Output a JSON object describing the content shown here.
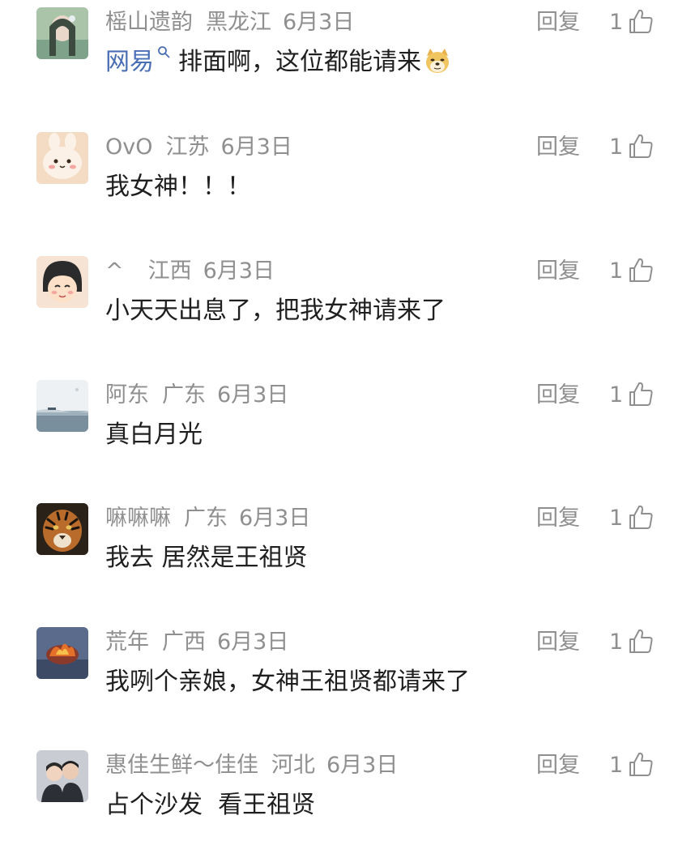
{
  "comments": [
    {
      "username": "榣山遗韵",
      "location": "黑龙江",
      "date": "6月3日",
      "link_word": "网易",
      "text": "排面啊，这位都能请来",
      "reply_label": "回复",
      "likes": "1",
      "avatar": "anime-girl-avatar"
    },
    {
      "username": "OvO",
      "location": "江苏",
      "date": "6月3日",
      "text": "我女神！！！",
      "reply_label": "回复",
      "likes": "1",
      "avatar": "bunny-avatar"
    },
    {
      "username": "^",
      "location": "江西",
      "date": "6月3日",
      "text": "小天天出息了，把我女神请来了",
      "reply_label": "回复",
      "likes": "1",
      "avatar": "cartoon-girl-avatar"
    },
    {
      "username": "阿东",
      "location": "广东",
      "date": "6月3日",
      "text": "真白月光",
      "reply_label": "回复",
      "likes": "1",
      "avatar": "sea-landscape-avatar"
    },
    {
      "username": "嘛嘛嘛",
      "location": "广东",
      "date": "6月3日",
      "text": "我去 居然是王祖贤",
      "reply_label": "回复",
      "likes": "1",
      "avatar": "tiger-avatar"
    },
    {
      "username": "荒年",
      "location": "广西",
      "date": "6月3日",
      "text": "我咧个亲娘，女神王祖贤都请来了",
      "reply_label": "回复",
      "likes": "1",
      "avatar": "fire-avatar"
    },
    {
      "username": "惠佳生鲜～佳佳",
      "location": "河北",
      "date": "6月3日",
      "text": "占个沙发  看王祖贤",
      "reply_label": "回复",
      "likes": "1",
      "avatar": "couple-photo-avatar"
    }
  ],
  "colors": {
    "meta_gray": "#8f8f8f",
    "text": "#1f1f1f",
    "link_blue": "#4a6fb5",
    "background": "#ffffff"
  },
  "icons": {
    "like": "thumbs-up-icon",
    "search": "search-icon",
    "emoji": "doge-emoji-icon"
  }
}
